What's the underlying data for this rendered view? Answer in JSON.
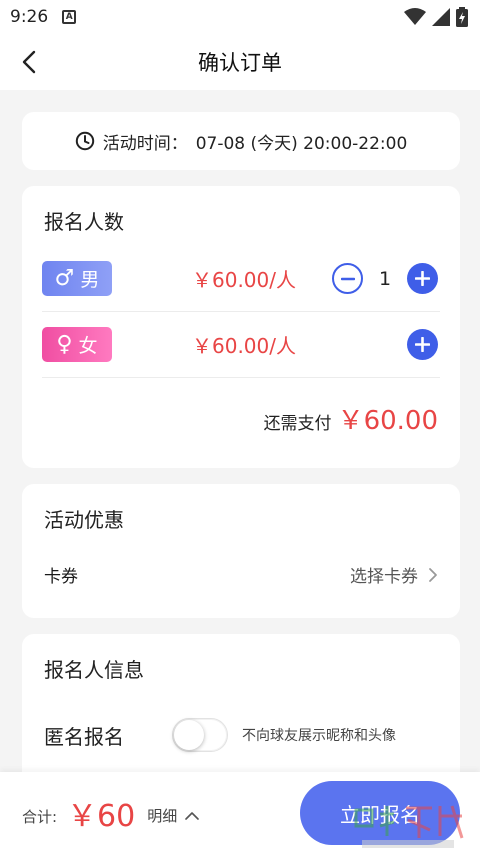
{
  "status_bar": {
    "time": "9:26"
  },
  "nav": {
    "title": "确认订单"
  },
  "activity_time": {
    "label": "活动时间：",
    "value": "07-08 (今天) 20:00-22:00"
  },
  "signup_count": {
    "title": "报名人数",
    "rows": [
      {
        "gender_symbol": "♂",
        "gender_label": "男",
        "price": "￥60.00/人",
        "quantity": "1"
      },
      {
        "gender_symbol": "♀",
        "gender_label": "女",
        "price": "￥60.00/人"
      }
    ],
    "remaining_label": "还需支付",
    "remaining_value": "￥60.00"
  },
  "promotions": {
    "title": "活动优惠",
    "coupon_label": "卡券",
    "coupon_value": "选择卡券"
  },
  "signup_info": {
    "title": "报名人信息",
    "anonymous_label": "匿名报名",
    "anonymous_hint": "不向球友展示昵称和头像",
    "anonymous_enabled": false
  },
  "footer": {
    "total_label": "合计:",
    "total_value": "￥60",
    "detail_label": "明细",
    "submit_label": "立即报名"
  },
  "colors": {
    "accent": "#3f5ee8",
    "button": "#5b74ef",
    "price": "#e84545",
    "male": "#7b8ff3",
    "female": "#f558ad"
  }
}
